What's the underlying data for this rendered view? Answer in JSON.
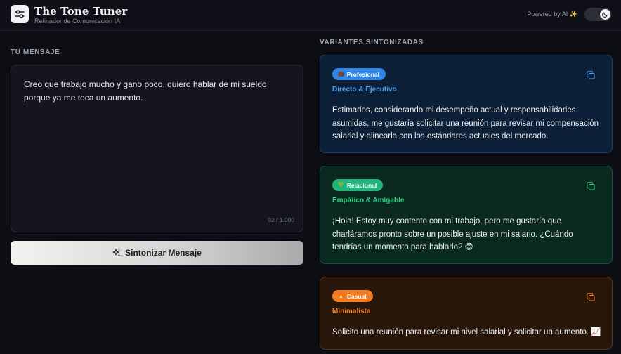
{
  "header": {
    "title": "The Tone Tuner",
    "subtitle": "Refinador de Comunicación IA",
    "powered_by": "Powered by AI ✨",
    "theme_toggle_icon": "moon-icon"
  },
  "input": {
    "section_label": "TU MENSAJE",
    "message": "Creo que trabajo mucho y gano poco, quiero hablar de mi sueldo porque ya me toca un aumento.",
    "char_count": "92 / 1.000",
    "tune_button_label": "Sintonizar Mensaje",
    "tune_button_icon": "sparkles-icon"
  },
  "variants": {
    "section_label": "VARIANTES SINTONIZADAS",
    "items": [
      {
        "badge": "Profesional",
        "badge_icon": "briefcase-icon",
        "subtitle": "Directo & Ejecutivo",
        "text": "Estimados, considerando mi desempeño actual y responsabilidades asumidas, me gustaría solicitar una reunión para revisar mi compensación salarial y alinearla con los estándares actuales del mercado.",
        "accent": "#2f86e6"
      },
      {
        "badge": "Relacional",
        "badge_icon": "heart-icon",
        "subtitle": "Empático & Amigable",
        "text": "¡Hola! Estoy muy contento con mi trabajo, pero me gustaría que charláramos pronto sobre un posible ajuste en mi salario. ¿Cuándo tendrías un momento para hablarlo? 😊",
        "accent": "#1fb57b"
      },
      {
        "badge": "Casual",
        "badge_icon": "fire-icon",
        "subtitle": "Minimalista",
        "text": "Solicito una reunión para revisar mi nivel salarial y solicitar un aumento. 📈",
        "accent": "#f27a21"
      }
    ]
  }
}
